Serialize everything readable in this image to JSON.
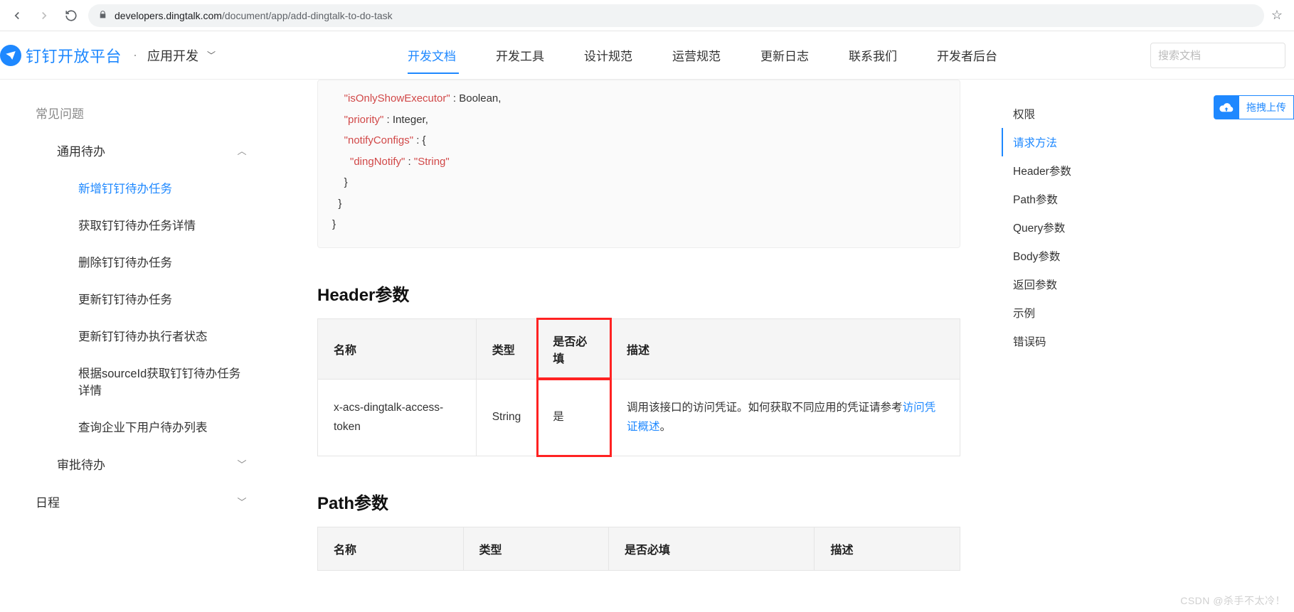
{
  "browser": {
    "url_host": "developers.dingtalk.com",
    "url_path": "/document/app/add-dingtalk-to-do-task"
  },
  "brand": {
    "name": "钉钉开放平台",
    "sub": "应用开发"
  },
  "nav": {
    "items": [
      "开发文档",
      "开发工具",
      "设计规范",
      "运营规范",
      "更新日志",
      "联系我们",
      "开发者后台"
    ],
    "active_index": 0,
    "search_placeholder": "搜索文档"
  },
  "upload": {
    "label": "拖拽上传"
  },
  "sidebar": {
    "top": "常见问题",
    "section1": "通用待办",
    "children": [
      "新增钉钉待办任务",
      "获取钉钉待办任务详情",
      "删除钉钉待办任务",
      "更新钉钉待办任务",
      "更新钉钉待办执行者状态",
      "根据sourceId获取钉钉待办任务详情",
      "查询企业下用户待办列表"
    ],
    "section2": "审批待办",
    "bottom": "日程"
  },
  "code": {
    "k1": "\"isOnlyShowExecutor\"",
    "v1": " : Boolean,",
    "k2": "\"priority\"",
    "v2": " : Integer,",
    "k3": "\"notifyConfigs\"",
    "v3": " : {",
    "k4": "\"dingNotify\"",
    "v4": " : ",
    "s4": "\"String\"",
    "close1": "  }",
    "close2": "}"
  },
  "sections": {
    "header_params_title": "Header参数",
    "path_params_title": "Path参数"
  },
  "table": {
    "headers": {
      "name": "名称",
      "type": "类型",
      "required": "是否必填",
      "desc": "描述"
    },
    "row1": {
      "name": "x-acs-dingtalk-access-token",
      "type": "String",
      "required": "是",
      "desc_prefix": "调用该接口的访问凭证。如何获取不同应用的凭证请参考",
      "desc_link": "访问凭证概述",
      "desc_suffix": "。"
    }
  },
  "toc": {
    "items": [
      "权限",
      "请求方法",
      "Header参数",
      "Path参数",
      "Query参数",
      "Body参数",
      "返回参数",
      "示例",
      "错误码"
    ],
    "active_index": 1
  },
  "watermark": "CSDN @杀手不太冷！"
}
